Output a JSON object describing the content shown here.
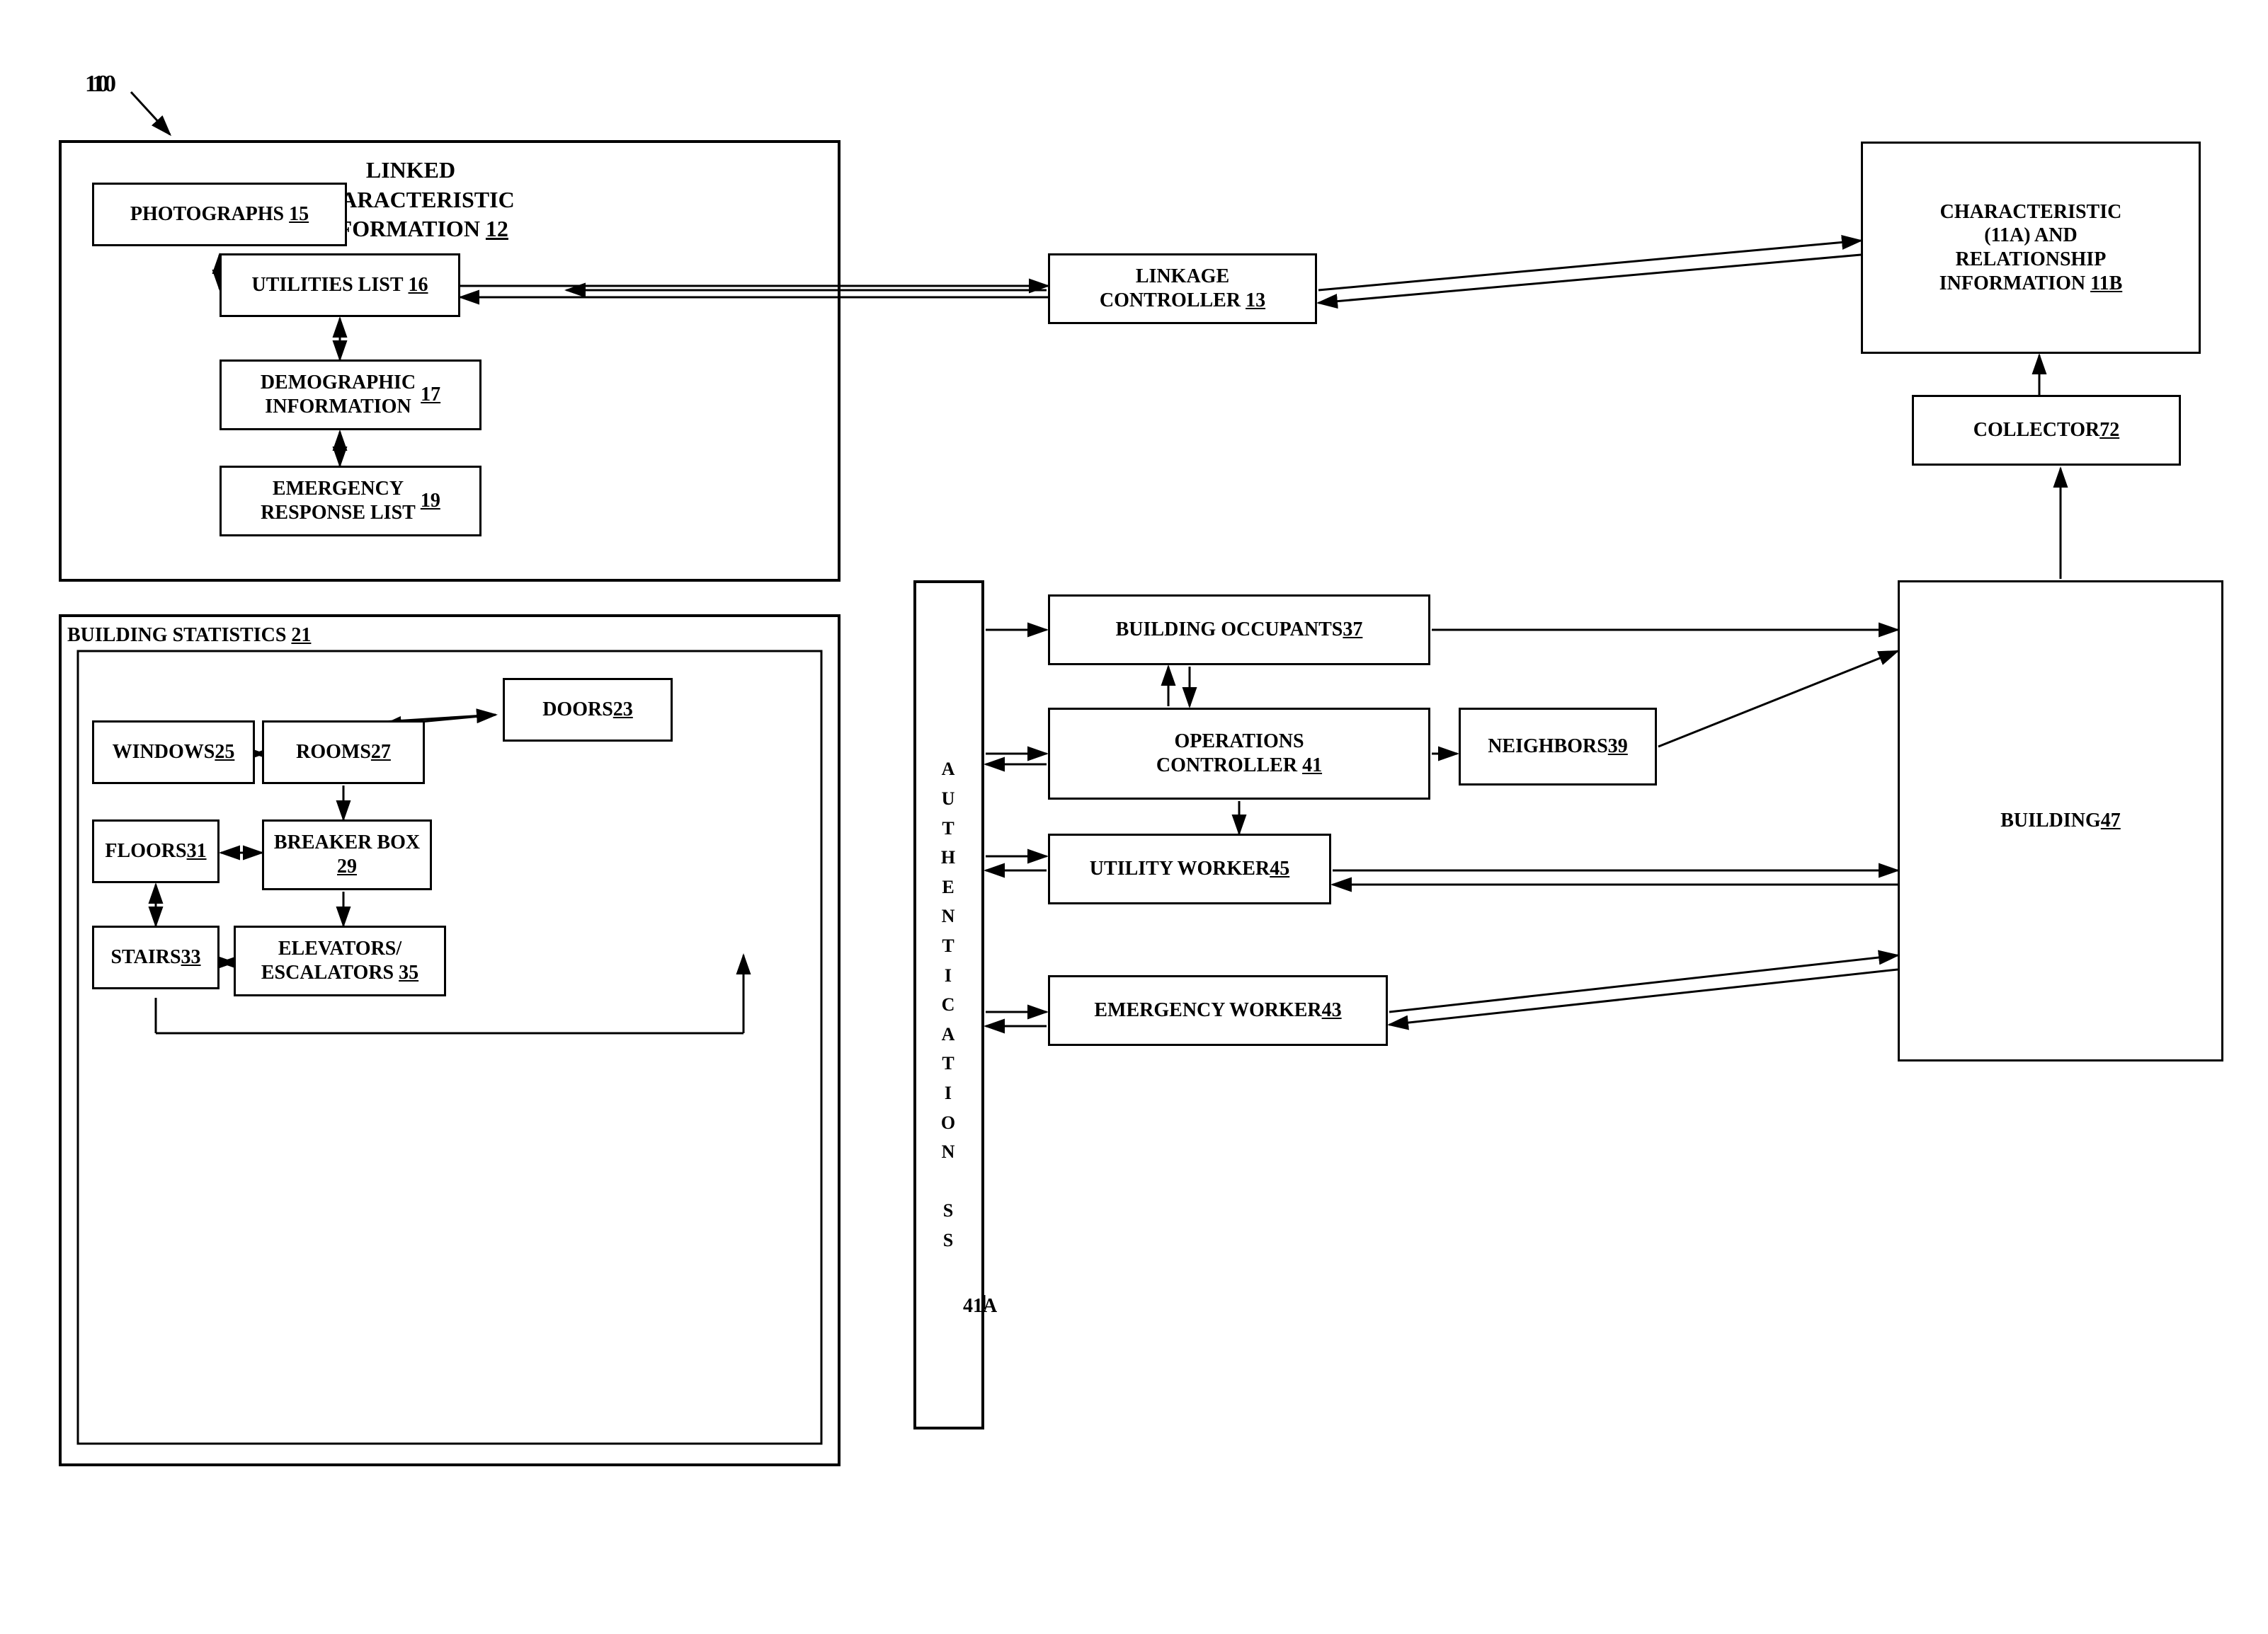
{
  "diagram": {
    "reference_label": "10",
    "nodes": {
      "photographs": {
        "label": "PHOTOGRAPHS",
        "ref": "15"
      },
      "linked_char_info": {
        "label": "LINKED\nCHARACTERISTIC\nINFORMATION",
        "ref": "12"
      },
      "utilities_list": {
        "label": "UTILITIES LIST",
        "ref": "16"
      },
      "demographic_info": {
        "label": "DEMOGRAPHIC\nINFORMATION",
        "ref": "17"
      },
      "emergency_response": {
        "label": "EMERGENCY\nRESPONSE LIST",
        "ref": "19"
      },
      "building_stats": {
        "label": "BUILDING STATISTICS",
        "ref": "21"
      },
      "doors": {
        "label": "DOORS",
        "ref": "23"
      },
      "windows": {
        "label": "WINDOWS",
        "ref": "25"
      },
      "rooms": {
        "label": "ROOMS",
        "ref": "27"
      },
      "breaker_box": {
        "label": "BREAKER BOX",
        "ref": "29"
      },
      "floors": {
        "label": "FLOORS",
        "ref": "31"
      },
      "stairs": {
        "label": "STAIRS",
        "ref": "33"
      },
      "elevators": {
        "label": "ELEVATORS/\nESCALATORS",
        "ref": "35"
      },
      "linkage_controller": {
        "label": "LINKAGE\nCONTROLLER",
        "ref": "13"
      },
      "characteristic_info": {
        "label": "CHARACTERISTIC\n(11A) AND\nRELATIONSHIP\nINFORMATION",
        "ref": "11B"
      },
      "collector": {
        "label": "COLLECTOR",
        "ref": "72"
      },
      "authentication": {
        "label": "A\nU\nT\nH\nE\nN\nT\nI\nC\nA\nT\nI\nO\nN\n\nS\nS"
      },
      "building_occupants": {
        "label": "BUILDING OCCUPANTS",
        "ref": "37"
      },
      "operations_controller": {
        "label": "OPERATIONS\nCONTROLLER",
        "ref": "41"
      },
      "neighbors": {
        "label": "NEIGHBORS",
        "ref": "39"
      },
      "utility_worker": {
        "label": "UTILITY WORKER",
        "ref": "45"
      },
      "emergency_worker": {
        "label": "EMERGENCY WORKER",
        "ref": "43"
      },
      "building": {
        "label": "BUILDING",
        "ref": "47"
      },
      "auth_label_41a": "41A"
    }
  }
}
